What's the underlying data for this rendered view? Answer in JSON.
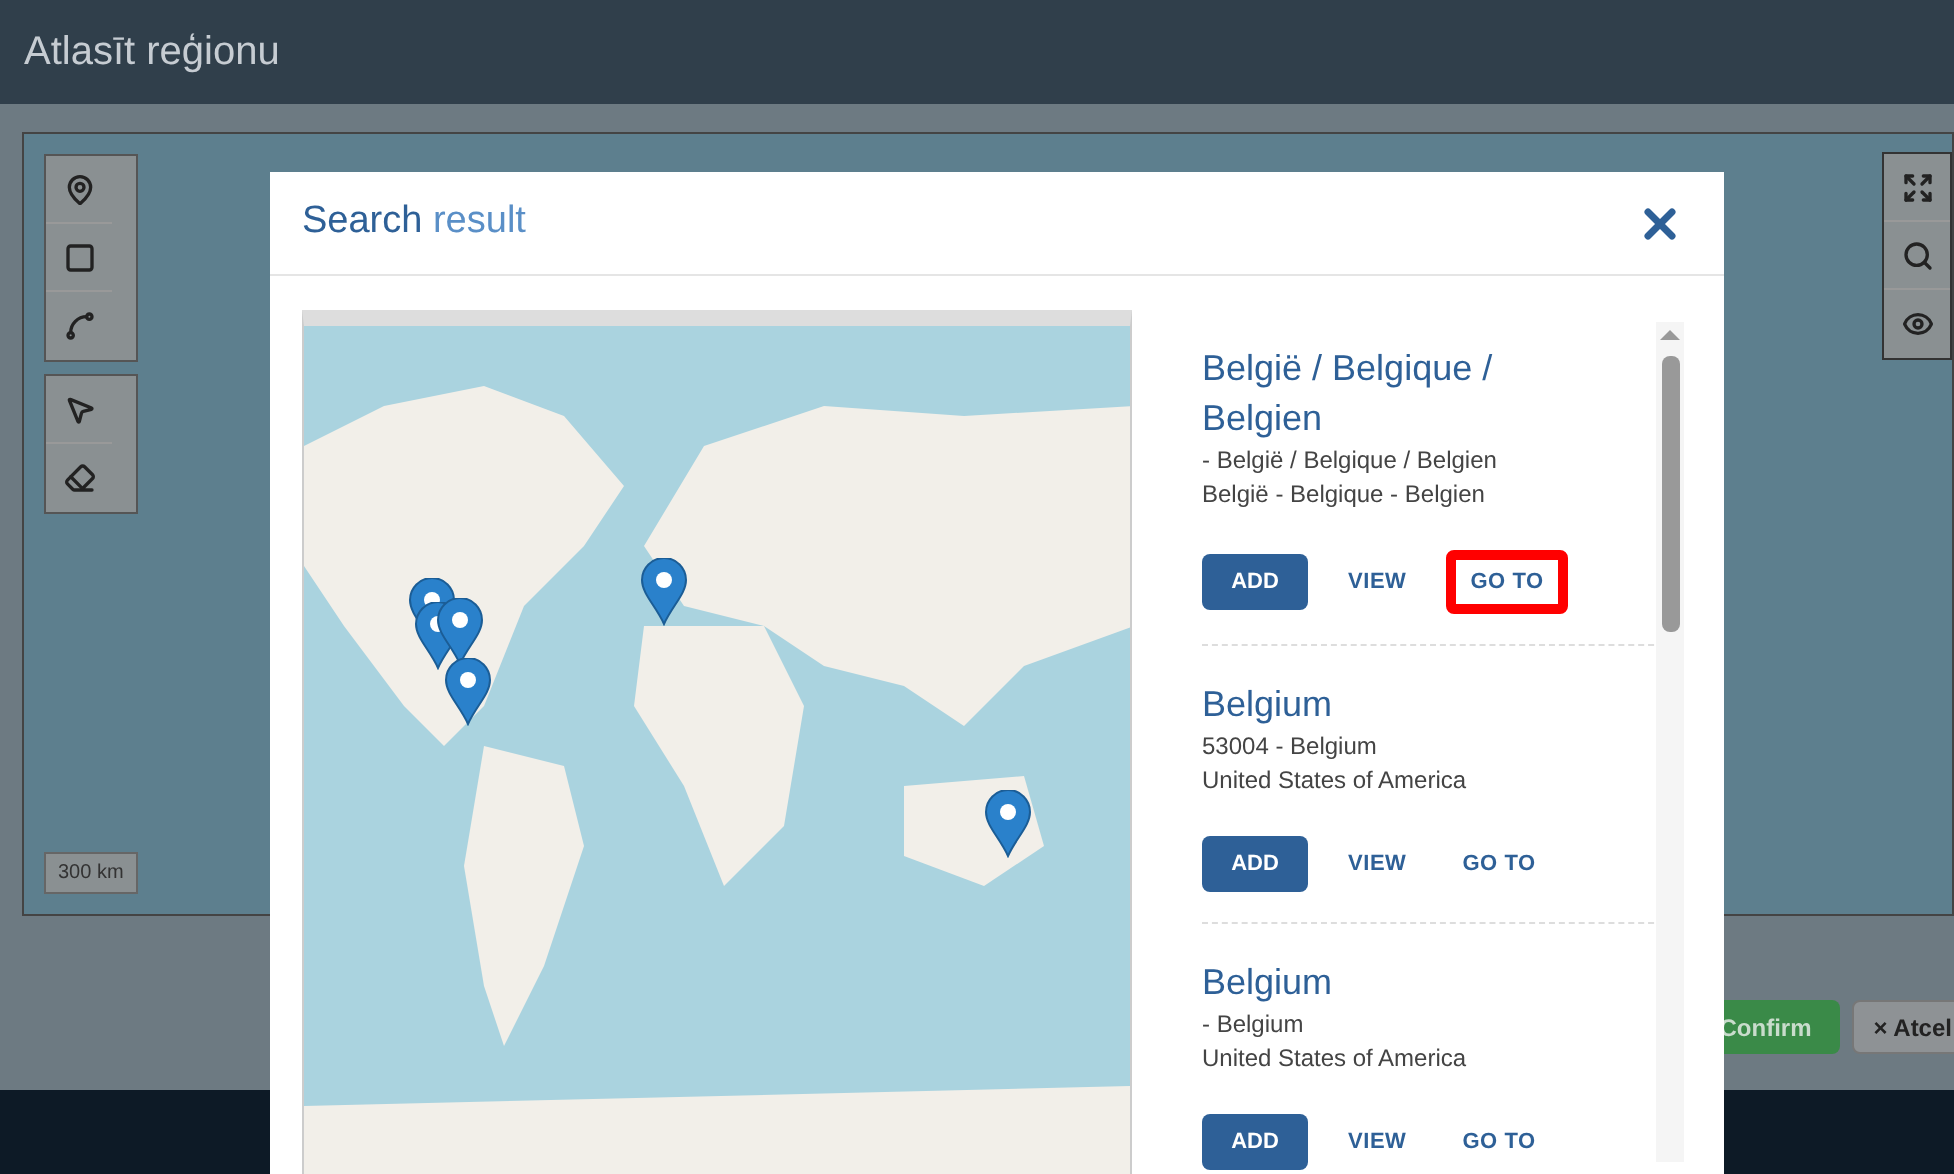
{
  "window": {
    "title": "Atlasīt reģionu"
  },
  "map": {
    "scale": "300 km"
  },
  "footer": {
    "buttons": [
      {
        "label": "Confirm",
        "kind": "primary"
      },
      {
        "label": "× Atcel",
        "kind": "secondary"
      }
    ]
  },
  "modal": {
    "title": "Search",
    "title_suffix": "result",
    "results": [
      {
        "title": "België / Belgique / Belgien",
        "lines": [
          "- België / Belgique / Belgien",
          "België - Belgique - Belgien"
        ],
        "actions": [
          {
            "label": "ADD",
            "kind": "primary",
            "highlighted": false
          },
          {
            "label": "VIEW",
            "kind": "link",
            "highlighted": false
          },
          {
            "label": "GO TO",
            "kind": "link",
            "highlighted": true
          }
        ]
      },
      {
        "title": "Belgium",
        "lines": [
          "53004 - Belgium",
          "United States of America"
        ],
        "actions": [
          {
            "label": "ADD",
            "kind": "primary",
            "highlighted": false
          },
          {
            "label": "VIEW",
            "kind": "link",
            "highlighted": false
          },
          {
            "label": "GO TO",
            "kind": "link",
            "highlighted": false
          }
        ]
      },
      {
        "title": "Belgium",
        "lines": [
          "- Belgium",
          "United States of America"
        ],
        "actions": [
          {
            "label": "ADD",
            "kind": "primary",
            "highlighted": false
          },
          {
            "label": "VIEW",
            "kind": "link",
            "highlighted": false
          },
          {
            "label": "GO TO",
            "kind": "link",
            "highlighted": false
          }
        ]
      }
    ]
  }
}
